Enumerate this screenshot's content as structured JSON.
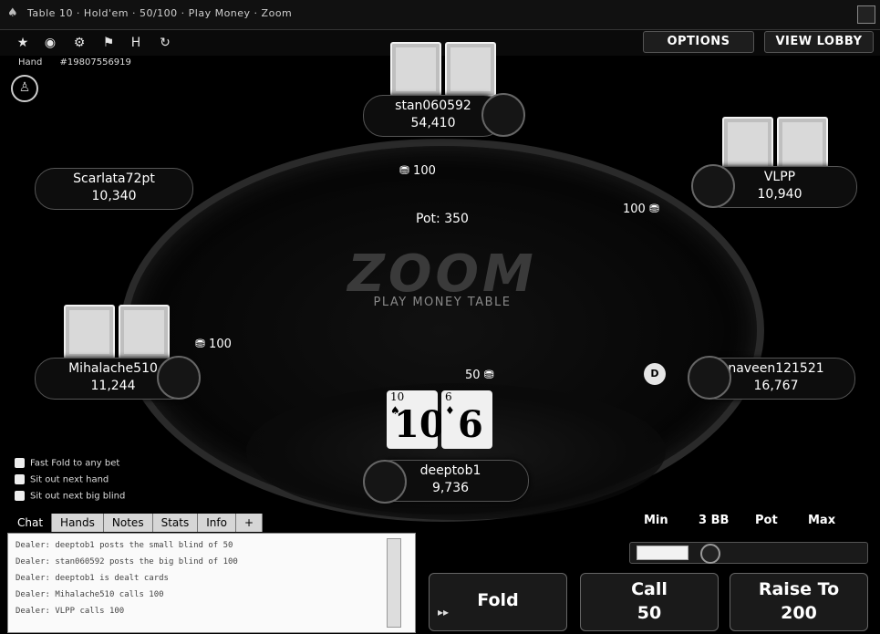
{
  "window": {
    "title": "Table 10 · Hold'em · 50/100 · Play Money · Zoom"
  },
  "toolbar": {
    "icons": [
      "star-icon",
      "chip-icon",
      "gear-icon",
      "flag-icon",
      "history-icon",
      "refresh-icon"
    ],
    "options_label": "OPTIONS",
    "lobby_label": "VIEW LOBBY"
  },
  "hand_info": {
    "label": "Hand",
    "number": "#19807556919"
  },
  "table": {
    "pot_label": "Pot: 350",
    "logo": "ZOOM",
    "subtitle": "PLAY MONEY TABLE"
  },
  "players": [
    {
      "name": "stan060592",
      "stack": "54,410",
      "bet": "100"
    },
    {
      "name": "Scarlata72pt",
      "stack": "10,340",
      "bet": ""
    },
    {
      "name": "VLPP",
      "stack": "10,940",
      "bet": "100"
    },
    {
      "name": "Mihalache510",
      "stack": "11,244",
      "bet": "100"
    },
    {
      "name": "naveen121521",
      "stack": "16,767",
      "bet": ""
    },
    {
      "name": "deeptob1",
      "stack": "9,736",
      "bet": "50"
    }
  ],
  "hero_cards": [
    {
      "rank": "10",
      "suit": "♠",
      "big": "10"
    },
    {
      "rank": "6",
      "suit": "♦",
      "big": "6"
    }
  ],
  "dealer_button": "D",
  "checkboxes": [
    "Fast Fold to any bet",
    "Sit out next hand",
    "Sit out next big blind"
  ],
  "tabs": [
    "Chat",
    "Hands",
    "Notes",
    "Stats",
    "Info",
    "+"
  ],
  "chat_lines": [
    "Dealer: deeptob1 posts the small blind of 50",
    "Dealer: stan060592 posts the big blind of 100",
    "Dealer: deeptob1 is dealt cards",
    "Dealer: Mihalache510 calls 100",
    "Dealer: VLPP calls 100"
  ],
  "bet_sizing": {
    "min": "Min",
    "three_bb": "3 BB",
    "pot": "Pot",
    "max": "Max"
  },
  "actions": {
    "fold": "Fold",
    "call_label": "Call",
    "call_amount": "50",
    "raise_label": "Raise To",
    "raise_amount": "200"
  }
}
